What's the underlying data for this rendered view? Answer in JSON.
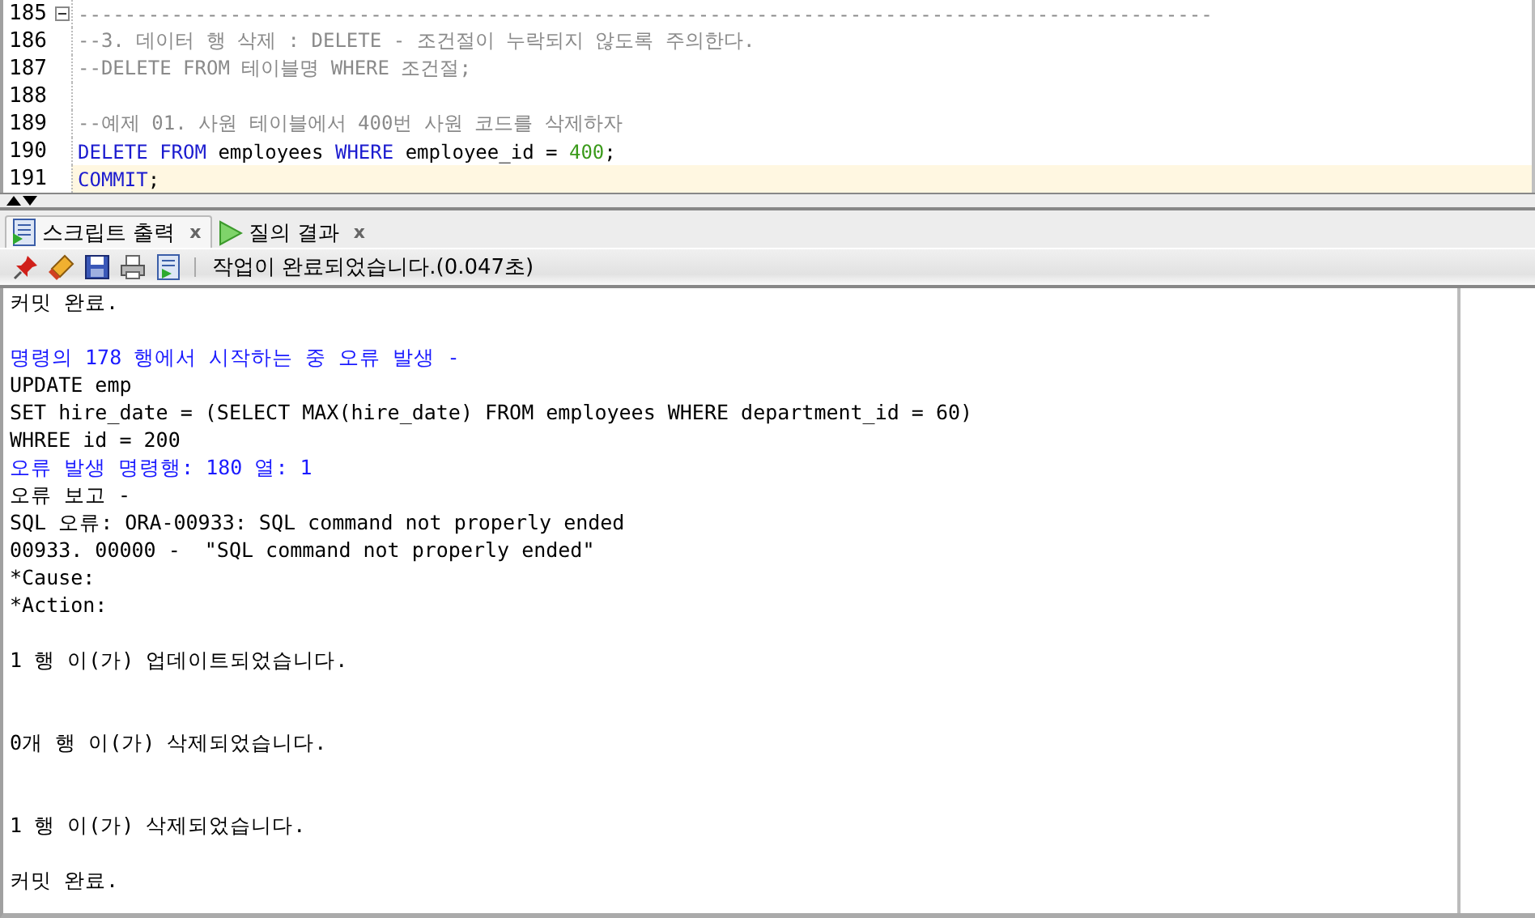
{
  "editor": {
    "lines": [
      {
        "number": "185",
        "fold": true,
        "current": false,
        "tokens": [
          {
            "kind": "comment",
            "text": "-------------------------------------------------------------------------------------------------"
          }
        ]
      },
      {
        "number": "186",
        "fold": false,
        "current": false,
        "tokens": [
          {
            "kind": "comment",
            "text": "--3. 데이터 행 삭제 : DELETE - 조건절이 누락되지 않도록 주의한다."
          }
        ]
      },
      {
        "number": "187",
        "fold": false,
        "current": false,
        "tokens": [
          {
            "kind": "comment",
            "text": "--DELETE FROM 테이블명 WHERE 조건절;"
          }
        ]
      },
      {
        "number": "188",
        "fold": false,
        "current": false
      },
      {
        "number": "189",
        "fold": false,
        "current": false,
        "tokens": [
          {
            "kind": "comment",
            "text": "--예제 01. 사원 테이블에서 400번 사원 코드를 삭제하자"
          }
        ]
      },
      {
        "number": "190",
        "fold": false,
        "current": false,
        "tokens": [
          {
            "kind": "keyword",
            "text": "DELETE FROM"
          },
          {
            "kind": "plain",
            "text": " employees "
          },
          {
            "kind": "keyword",
            "text": "WHERE"
          },
          {
            "kind": "plain",
            "text": " employee_id = "
          },
          {
            "kind": "number",
            "text": "400"
          },
          {
            "kind": "plain",
            "text": ";"
          }
        ]
      },
      {
        "number": "191",
        "fold": false,
        "current": true,
        "tokens": [
          {
            "kind": "keyword",
            "text": "COMMIT"
          },
          {
            "kind": "plain",
            "text": ";"
          }
        ]
      }
    ]
  },
  "tabs": [
    {
      "label": "스크립트 출력",
      "selected": true,
      "close": "x"
    },
    {
      "label": "질의 결과",
      "selected": false,
      "close": "x"
    }
  ],
  "toolbar": {
    "status": "작업이 완료되었습니다.(0.047초)"
  },
  "output": {
    "lines": [
      {
        "kind": "normal",
        "text": "커밋 완료."
      },
      {
        "kind": "blank"
      },
      {
        "kind": "error",
        "text": "명령의 178 행에서 시작하는 중 오류 발생 -"
      },
      {
        "kind": "normal",
        "text": "UPDATE emp"
      },
      {
        "kind": "normal",
        "text": "SET hire_date = (SELECT MAX(hire_date) FROM employees WHERE department_id = 60)"
      },
      {
        "kind": "normal",
        "text": "WHREE id = 200"
      },
      {
        "kind": "error",
        "text": "오류 발생 명령행: 180 열: 1"
      },
      {
        "kind": "normal",
        "text": "오류 보고 -"
      },
      {
        "kind": "normal",
        "text": "SQL 오류: ORA-00933: SQL command not properly ended"
      },
      {
        "kind": "normal",
        "text": "00933. 00000 -  \"SQL command not properly ended\""
      },
      {
        "kind": "normal",
        "text": "*Cause:"
      },
      {
        "kind": "normal",
        "text": "*Action:"
      },
      {
        "kind": "blank"
      },
      {
        "kind": "normal",
        "text": "1 행 이(가) 업데이트되었습니다."
      },
      {
        "kind": "blank"
      },
      {
        "kind": "blank"
      },
      {
        "kind": "normal",
        "text": "0개 행 이(가) 삭제되었습니다."
      },
      {
        "kind": "blank"
      },
      {
        "kind": "blank"
      },
      {
        "kind": "normal",
        "text": "1 행 이(가) 삭제되었습니다."
      },
      {
        "kind": "blank"
      },
      {
        "kind": "normal",
        "text": "커밋 완료."
      }
    ]
  }
}
